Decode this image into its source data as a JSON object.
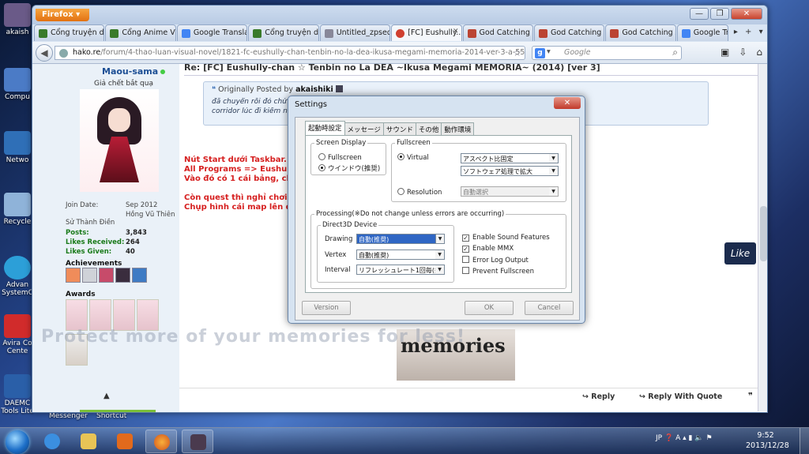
{
  "desktop": {
    "icons": [
      {
        "label": "akaish",
        "color": "#6a5a88"
      },
      {
        "label": "Compu",
        "color": "#4b7bc6"
      },
      {
        "label": "Netwo",
        "color": "#2f6fb7"
      },
      {
        "label": "Recycle",
        "color": "#8fb3d9"
      },
      {
        "label": "Advan SystemC",
        "color": "#2c9fd8"
      },
      {
        "label": "Avira Co Cente",
        "color": "#d12b2b"
      },
      {
        "label": "DAEMC Tools Lite",
        "color": "#2a5fa8"
      }
    ],
    "bottom_labels": [
      "Messenger",
      "Shortcut"
    ]
  },
  "browser": {
    "app_button": "Firefox",
    "tabs": [
      {
        "label": "Cổng truyện dị...",
        "icon": "hako-favicon"
      },
      {
        "label": "Cổng Anime Vi...",
        "icon": "hako-favicon"
      },
      {
        "label": "Google Translate",
        "icon": "google-favicon"
      },
      {
        "label": "Cổng truyện dị...",
        "icon": "hako-favicon"
      },
      {
        "label": "Untitled_zpsed1...",
        "icon": "page-favicon"
      },
      {
        "label": "[FC] Eushully...",
        "icon": "hako-favicon",
        "active": true
      },
      {
        "label": "God Catching A...",
        "icon": "game-favicon"
      },
      {
        "label": "God Catching A...",
        "icon": "game-favicon"
      },
      {
        "label": "God Catching A...",
        "icon": "game-favicon"
      },
      {
        "label": "Google Translate",
        "icon": "google-favicon"
      }
    ],
    "url_host": "hako.re",
    "url_path": "/forum/4-thao-luan-visual-novel/1821-fc-eushully-chan-tenbin-no-la-dea-ikusa-megami-memoria-2014-ver-3-a-551.html",
    "search_placeholder": "Google"
  },
  "forum": {
    "user": {
      "name": "Maou-sama",
      "title": "Giả chết bắt quạ",
      "join_label": "Join Date:",
      "join_value": "Sep 2012",
      "location_label": "Sử Thành Điền",
      "location_value": "Hồng Vũ Thiên",
      "posts_label": "Posts:",
      "posts_value": "3,843",
      "likes_received_label": "Likes Received:",
      "likes_received_value": "264",
      "likes_given_label": "Likes Given:",
      "likes_given_value": "40",
      "achievements_label": "Achievements",
      "awards_label": "Awards"
    },
    "post": {
      "title": "Re: [FC] Eushully-chan ☆ Tenbin no La DEA ~Ikusa Megami MEMORIA~ (2014) [ver 3]",
      "quote_prefix": "Originally Posted by",
      "quote_author": "akaishiki",
      "quote_line1": "đã chuyển rồi đó chứ tất cả ... không đi được ở sediment",
      "quote_line2": "corridor lúc đi kiếm ngư ... ra kill làm thế nào đây ?",
      "lines": [
        "Nút Start dưới Taskbar.",
        "All Programs => Eushully",
        "Vào đó có 1 cái bảng, ch",
        "Còn quest thì nghỉ chơi l",
        "Chụp hình cái map lên đâ"
      ],
      "image_text": "memories",
      "reply": "Reply",
      "reply_quote": "Reply With Quote"
    },
    "like_label": "Like"
  },
  "watermarks": [
    "photobucket",
    "Protect more of your memories for less!"
  ],
  "dialog": {
    "title": "Settings",
    "close": "✕",
    "tabs": [
      "起動時設定",
      "メッセージ",
      "サウンド",
      "その他",
      "動作環境"
    ],
    "screen_display": {
      "legend": "Screen Display",
      "fullscreen": "Fullscreen",
      "window": "ウインドウ(推奨)"
    },
    "fullscreen_group": {
      "legend": "Fullscreen",
      "virtual": "Virtual",
      "virtual_opt1": "アスペクト比固定",
      "virtual_opt2": "ソフトウェア処理で拡大",
      "resolution": "Resolution",
      "resolution_opt": "自動選択"
    },
    "processing": {
      "legend": "Processing(※Do not change unless errors are occurring)",
      "d3d_legend": "Direct3D Device",
      "drawing_label": "Drawing",
      "drawing_value": "自動(推奨)",
      "vertex_label": "Vertex",
      "vertex_value": "自動(推奨)",
      "interval_label": "Interval",
      "interval_value": "リフレッシュレート1回毎(推奨)",
      "checks": [
        {
          "label": "Enable Sound Features",
          "checked": true
        },
        {
          "label": "Enable MMX",
          "checked": true
        },
        {
          "label": "Error Log Output",
          "checked": false
        },
        {
          "label": "Prevent Fullscreen",
          "checked": false
        }
      ]
    },
    "buttons": {
      "version": "Version",
      "ok": "OK",
      "cancel": "Cancel"
    }
  },
  "taskbar": {
    "lang": "JP",
    "time": "9:52",
    "date": "2013/12/28"
  }
}
